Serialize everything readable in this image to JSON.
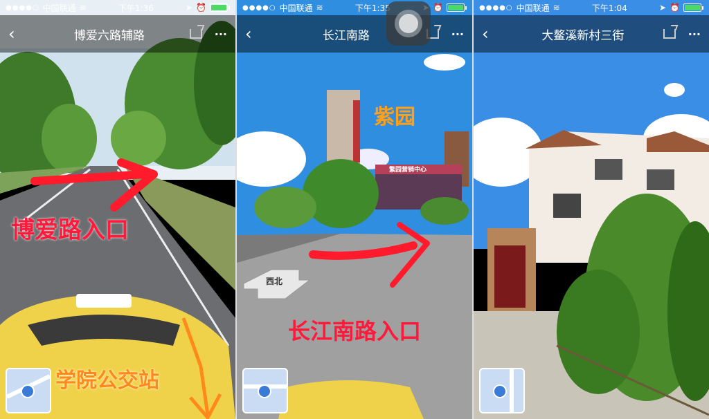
{
  "panels": [
    {
      "status": {
        "carrier": "中国联通",
        "time": "下午1:36"
      },
      "nav": {
        "back": "‹",
        "title": "博爱六路辅路",
        "more": "···"
      },
      "labels": {
        "main": "博爱路入口",
        "secondary": "学院公交站"
      },
      "colors": {
        "label": "#ff1a3c",
        "label2": "#ff8a1a",
        "arrow": "#ff1a2c"
      }
    },
    {
      "status": {
        "carrier": "中国联通",
        "time": "下午1:35"
      },
      "nav": {
        "back": "‹",
        "title": "长江南路",
        "more": "···"
      },
      "labels": {
        "main": "长江南路入口",
        "secondary": "紫园",
        "road_arrow": "西北",
        "sign": "繁园营销中心"
      },
      "colors": {
        "label": "#ff1a3c",
        "label2": "#ff9f1a",
        "arrow": "#ff1a2c"
      }
    },
    {
      "status": {
        "carrier": "中国联通",
        "time": "下午1:04"
      },
      "nav": {
        "back": "‹",
        "title": "大鳌溪新村三街",
        "more": "···"
      },
      "labels": {},
      "colors": {}
    }
  ],
  "icons": [
    "signal-dots-icon",
    "wifi-icon",
    "location-icon",
    "alarm-icon",
    "battery-icon",
    "back-icon",
    "share-icon",
    "more-icon",
    "minimap-icon",
    "assistive-touch-icon"
  ]
}
